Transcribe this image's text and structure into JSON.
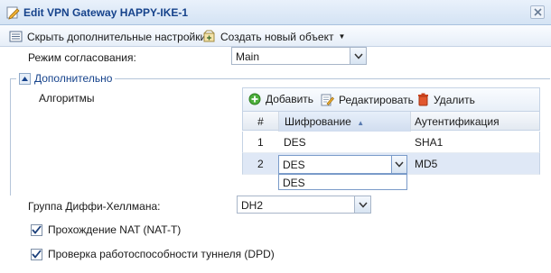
{
  "window": {
    "title": "Edit VPN Gateway HAPPY-IKE-1",
    "accent": "#15428b"
  },
  "toolbar": {
    "hide_advanced": "Скрыть дополнительные настройки",
    "create_object": "Создать новый объект"
  },
  "negotiation": {
    "label": "Режим согласования:",
    "value": "Main"
  },
  "advanced": {
    "legend": "Дополнительно"
  },
  "algorithms": {
    "label": "Алгоритмы",
    "add": "Добавить",
    "edit": "Редактировать",
    "delete": "Удалить",
    "columns": [
      "#",
      "Шифрование",
      "Аутентификация"
    ],
    "rows": [
      {
        "num": "1",
        "enc": "DES",
        "auth": "SHA1"
      },
      {
        "num": "2",
        "enc": "DES",
        "auth": "MD5"
      }
    ],
    "editor_value": "DES",
    "dropdown_options": [
      "DES"
    ]
  },
  "dh": {
    "label": "Группа Диффи-Хеллмана:",
    "value": "DH2"
  },
  "checkboxes": {
    "nat": {
      "label": "Прохождение NAT (NAT-T)",
      "checked": true
    },
    "dpd": {
      "label": "Проверка работоспособности туннеля (DPD)",
      "checked": true
    }
  }
}
